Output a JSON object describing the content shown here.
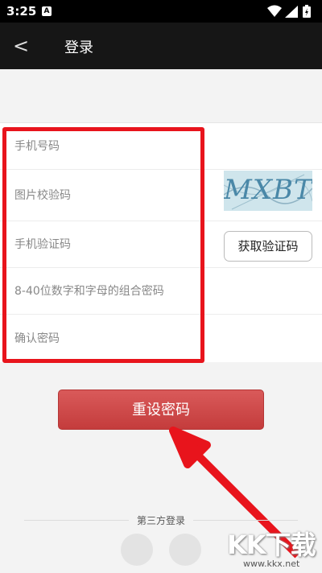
{
  "status_bar": {
    "time": "3:25",
    "notification_glyph": "A",
    "icons": [
      "wifi-icon",
      "signal-icon",
      "battery-icon"
    ]
  },
  "app_bar": {
    "back_glyph": "<",
    "title": "登录"
  },
  "form": {
    "phone_placeholder": "手机号码",
    "captcha_placeholder": "图片校验码",
    "sms_code_placeholder": "手机验证码",
    "password_placeholder": "8-40位数字和字母的组合密码",
    "confirm_placeholder": "确认密码"
  },
  "captcha": {
    "text": "MXBT"
  },
  "get_code_button": {
    "label": "获取验证码"
  },
  "reset_button": {
    "label": "重设密码"
  },
  "third_party": {
    "label": "第三方登录"
  },
  "watermark": {
    "brand": "KK下载",
    "url": "www.kkx.net"
  },
  "colors": {
    "app_bar": "#161616",
    "accent_red": "#c43c3c",
    "highlight_red": "#e8141c"
  }
}
